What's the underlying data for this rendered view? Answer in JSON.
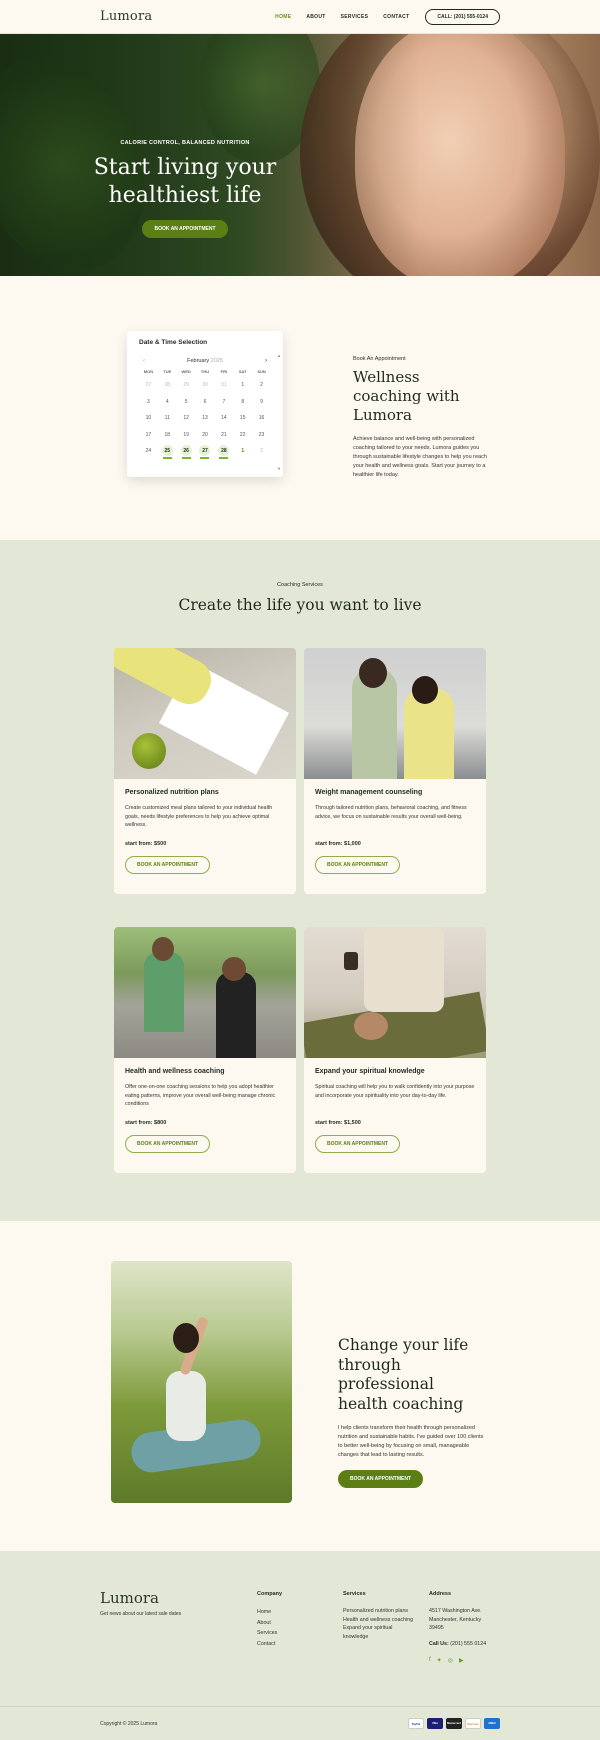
{
  "brand": {
    "name": "Lumora"
  },
  "header": {
    "nav": [
      "HOME",
      "ABOUT",
      "SERVICES",
      "CONTACT"
    ],
    "call_label": "CALL: (201) 555-0124"
  },
  "hero": {
    "eyebrow": "CALORIE CONTROL, BALANCED NUTRITION",
    "title": "Start living your healthiest life",
    "button": "BOOK AN APPOINTMENT"
  },
  "booking": {
    "calendar_title": "Date & Time Selection",
    "month": "February",
    "year": "2025",
    "weekdays": [
      "MON",
      "TUE",
      "WED",
      "THU",
      "FRI",
      "SAT",
      "SUN"
    ],
    "days": [
      [
        "27",
        "28",
        "29",
        "30",
        "31",
        "1",
        "2"
      ],
      [
        "3",
        "4",
        "5",
        "6",
        "7",
        "8",
        "9"
      ],
      [
        "10",
        "11",
        "12",
        "13",
        "14",
        "15",
        "16"
      ],
      [
        "17",
        "18",
        "19",
        "20",
        "21",
        "22",
        "23"
      ],
      [
        "24",
        "25",
        "26",
        "27",
        "28",
        "1",
        "2"
      ]
    ],
    "eyebrow": "Book An Appointment",
    "title": "Wellness coaching with Lumora",
    "body": "Achieve balance and well-being with personalized coaching tailored to your needs. Lumora guides you through sustainable lifestyle changes to help you reach your health and wellness goals. Start your journey to a healthier life today."
  },
  "services": {
    "eyebrow": "Coaching Services",
    "title": "Create the life you want to live",
    "cards": [
      {
        "title": "Personalized nutrition plans",
        "desc": "Create customized meal plans tailored to your individual health goals, needs lifestyle preferences to help you achieve optimal wellness.",
        "price": "start from: $500",
        "button": "BOOK AN APPOINTMENT"
      },
      {
        "title": "Weight management counseling",
        "desc": "Through tailored nutrition plans, behavioral coaching, and fitness advice, we focus on sustainable results your overall well-being.",
        "price": "start from: $1,000",
        "button": "BOOK AN APPOINTMENT"
      },
      {
        "title": "Health and wellness coaching",
        "desc": "Offer one-on-one coaching sessions to help you adopt healthier eating patterns, improve your overall well-being manage chronic conditions",
        "price": "start from: $800",
        "button": "BOOK AN APPOINTMENT"
      },
      {
        "title": "Expand your spiritual knowledge",
        "desc": "Spiritual coaching will help you to walk confidently into your purpose and incorporate your spirituality into your day-to-day life.",
        "price": "start from: $1,500",
        "button": "BOOK AN APPOINTMENT"
      }
    ]
  },
  "promo": {
    "title": "Change your life through professional health coaching",
    "body": "I help clients transform their health through personalized nutrition and sustainable habits. I've guided over 100 clients to better well-being by focusing on small, manageable changes that lead to lasting results.",
    "button": "BOOK AN APPOINTMENT"
  },
  "footer": {
    "logo": "Lumora",
    "tagline": "Get news about our latest sale dates",
    "company_heading": "Company",
    "company_links": [
      "Home",
      "About",
      "Services",
      "Contact"
    ],
    "services_heading": "Services",
    "services_links": [
      "Personalized nutrition plans",
      "Health and wellness coaching",
      "Expand your spiritual",
      "knowledge"
    ],
    "address_heading": "Address",
    "address_lines": [
      "4517 Washington Ave.",
      "Manchester, Kentucky",
      "39495"
    ],
    "call_label": "Call Us:",
    "call_number": "(201) 555 0124",
    "social_icons": [
      "facebook-icon",
      "twitter-icon",
      "instagram-icon",
      "youtube-icon"
    ],
    "copyright": "Copyright © 2025 Lumora",
    "payments": [
      "PayPal",
      "VISA",
      "Mastercard",
      "Discover",
      "AMEX"
    ]
  },
  "colors": {
    "accent": "#5b7f14",
    "section_bg": "#e2e8d5",
    "page_bg": "#fdf9f1"
  }
}
